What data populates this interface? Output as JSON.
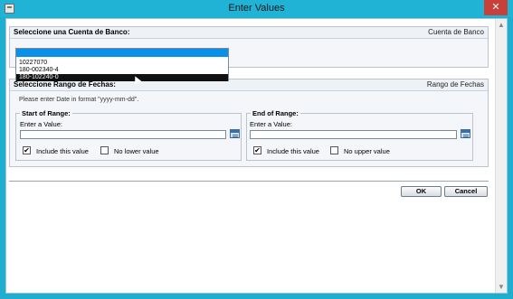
{
  "window": {
    "title": "Enter Values",
    "close_glyph": "✕"
  },
  "bank_section": {
    "header_left": "Seleccione una Cuenta de Banco:",
    "header_right": "Cuenta de Banco",
    "options": [
      "",
      "10227070",
      "180-002340-4",
      "180-102240-0"
    ]
  },
  "date_section": {
    "header_left": "Seleccione Rango de Fechas:",
    "header_right": "Rango de Fechas",
    "hint": "Please enter Date in format \"yyyy-mm-dd\".",
    "start": {
      "legend": "Start of Range:",
      "enter_label": "Enter a Value:",
      "value": "",
      "include_label": "Include this value",
      "include_checked": "✔",
      "bound_label": "No lower value"
    },
    "end": {
      "legend": "End of Range:",
      "enter_label": "Enter a Value:",
      "value": "",
      "include_label": "Include this value",
      "include_checked": "✔",
      "bound_label": "No upper value"
    }
  },
  "buttons": {
    "ok": "OK",
    "cancel": "Cancel"
  },
  "colors": {
    "titlebar": "#20b3d6",
    "close": "#c7403a",
    "selection": "#0a90e8"
  }
}
